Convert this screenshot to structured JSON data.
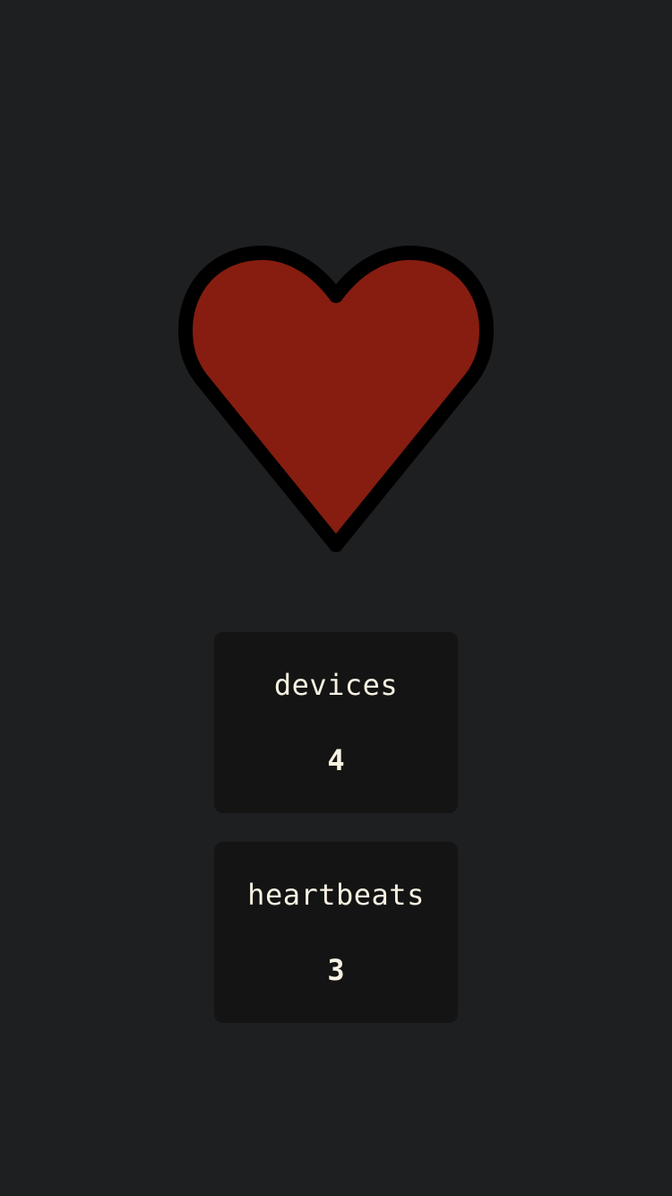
{
  "colors": {
    "background": "#1e1f21",
    "heart_fill": "#861d10",
    "heart_outline": "#000000",
    "card_background": "#141414",
    "card_text": "#f6f1e1"
  },
  "heart": {
    "icon": "heart-icon"
  },
  "stats": [
    {
      "label": "devices",
      "value": "4"
    },
    {
      "label": "heartbeats",
      "value": "3"
    }
  ]
}
